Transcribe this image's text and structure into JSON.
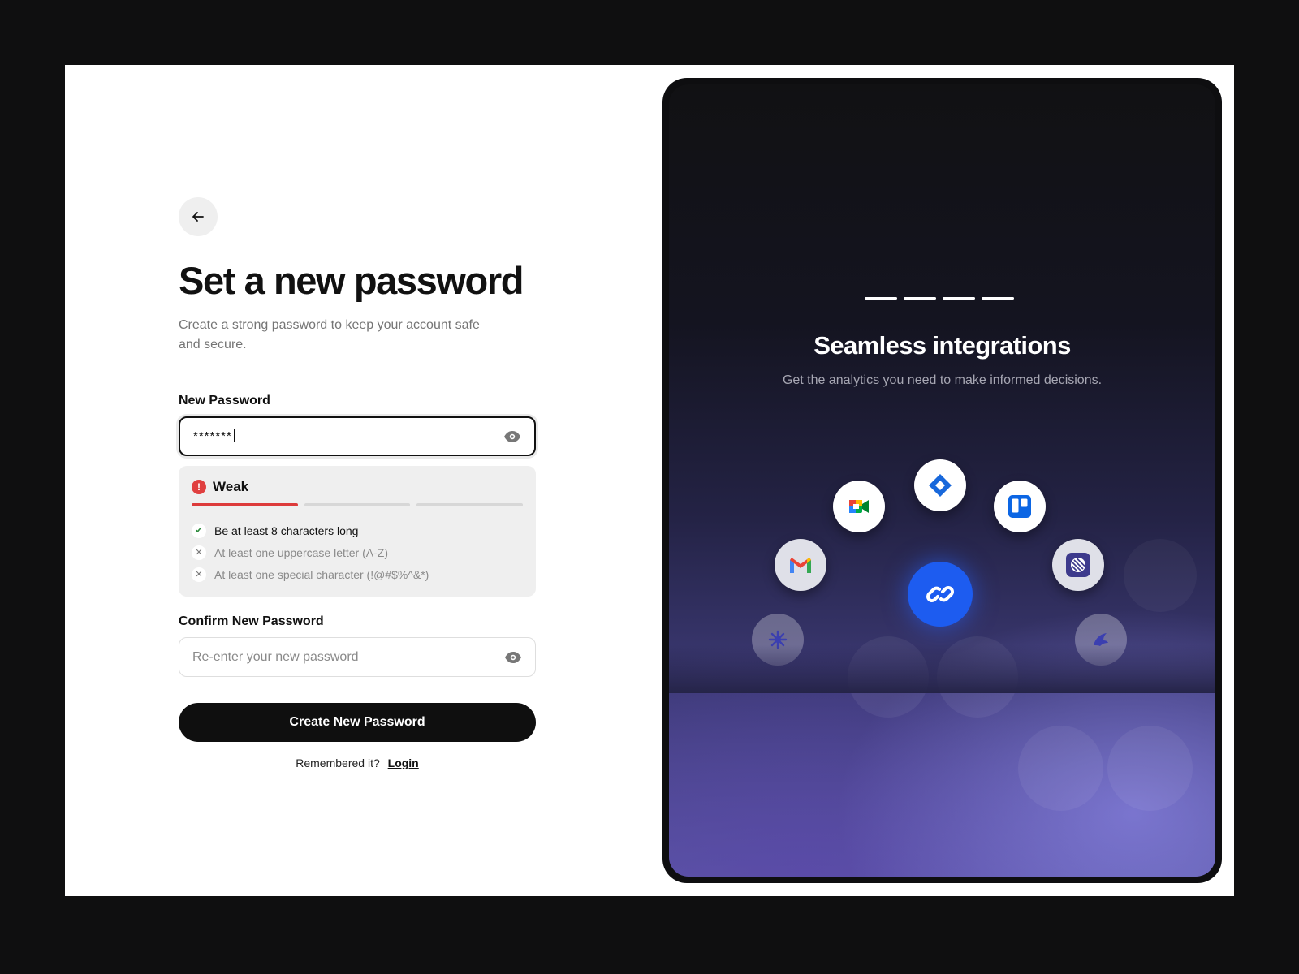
{
  "form": {
    "title": "Set a new password",
    "subtitle": "Create a strong password to keep your account safe and secure.",
    "new_password": {
      "label": "New Password",
      "value": "*******"
    },
    "strength": {
      "level": "Weak",
      "filled_segments": 1,
      "total_segments": 3,
      "rules": [
        {
          "text": "Be at least 8 characters long",
          "met": true
        },
        {
          "text": "At least one uppercase letter (A-Z)",
          "met": false
        },
        {
          "text": "At least one special character (!@#$%^&*)",
          "met": false
        }
      ]
    },
    "confirm_password": {
      "label": "Confirm New Password",
      "placeholder": "Re-enter your new password"
    },
    "submit_label": "Create New Password",
    "footer_text": "Remembered it?",
    "footer_link": "Login"
  },
  "panel": {
    "title": "Seamless integrations",
    "subtitle": "Get the analytics you need to make informed decisions.",
    "integrations": [
      "gmail-icon",
      "google-meet-icon",
      "jira-icon",
      "trello-icon",
      "linear-icon",
      "asterisk-app-icon",
      "fish-app-icon",
      "link-icon"
    ]
  },
  "colors": {
    "primary": "#0f0f0f",
    "weak": "#dd3b3b",
    "pass": "#2e8b3e",
    "hub": "#1d5cf0"
  }
}
